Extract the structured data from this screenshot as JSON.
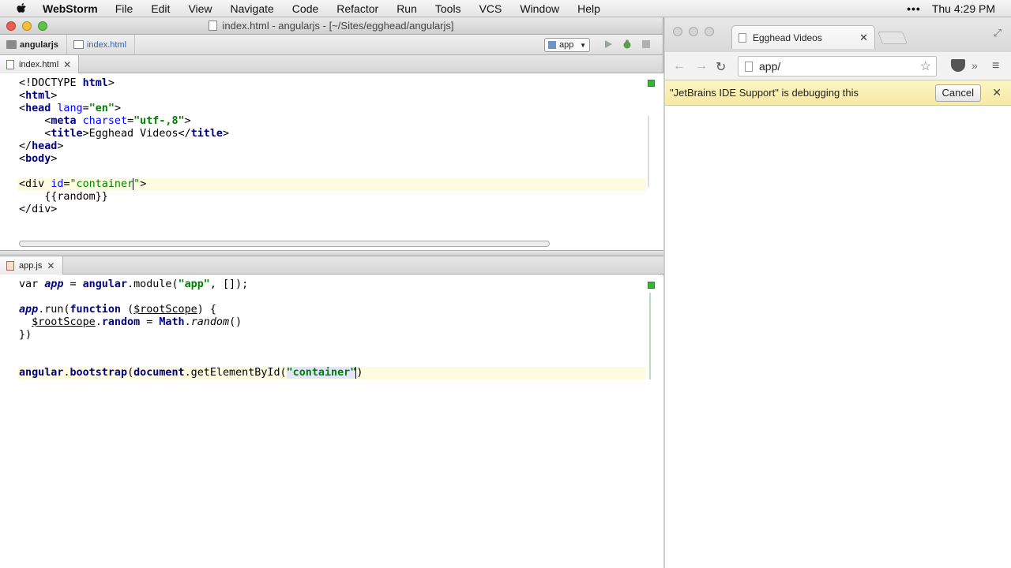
{
  "menubar": {
    "app_name": "WebStorm",
    "items": [
      "File",
      "Edit",
      "View",
      "Navigate",
      "Code",
      "Refactor",
      "Run",
      "Tools",
      "VCS",
      "Window",
      "Help"
    ],
    "clock": "Thu 4:29 PM"
  },
  "ide": {
    "window_title": "index.html - angularjs - [~/Sites/egghead/angularjs]",
    "breadcrumbs": [
      "angularjs",
      "index.html"
    ],
    "run_config": "app",
    "top_tab": "index.html",
    "bottom_tab": "app.js",
    "html_lines": [
      "<!DOCTYPE html>",
      "<html>",
      "<head lang=\"en\">",
      "    <meta charset=\"utf-,8\">",
      "    <title>Egghead Videos</title>",
      "</head>",
      "<body>",
      "",
      "<div id=\"container\">",
      "    {{random}}",
      "</div>"
    ],
    "js_lines": [
      "var app = angular.module(\"app\", []);",
      "",
      "app.run(function ($rootScope) {",
      "  $rootScope.random = Math.random()",
      "})",
      "",
      "",
      "angular.bootstrap(document.getElementById(\"container\"))"
    ]
  },
  "browser": {
    "tab_title": "Egghead Videos",
    "url": "app/",
    "info_message": "\"JetBrains IDE Support\" is debugging this",
    "cancel_label": "Cancel"
  },
  "colors": {
    "keyword": "#000080",
    "string": "#008000",
    "attribute": "#0000ff",
    "caret_line": "#fffbe0",
    "infobar": "#f7e9a5"
  }
}
